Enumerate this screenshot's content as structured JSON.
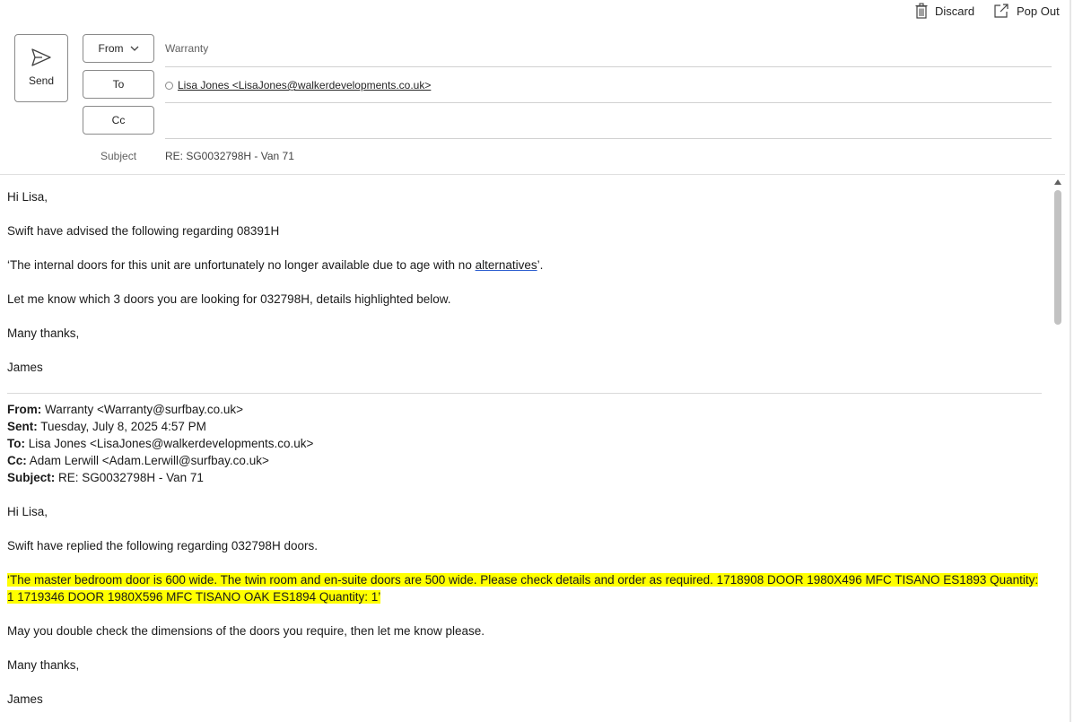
{
  "toolbar": {
    "discard_label": "Discard",
    "popout_label": "Pop Out"
  },
  "header": {
    "send_label": "Send",
    "from_label": "From",
    "to_label": "To",
    "cc_label": "Cc",
    "from_value": "Warranty",
    "to_recipient": "Lisa Jones <LisaJones@walkerdevelopments.co.uk>",
    "cc_value": "",
    "subject_label": "Subject",
    "subject_value": "RE: SG0032798H - Van 71"
  },
  "message": {
    "greeting": "Hi Lisa,",
    "line1": "Swift have advised the following regarding 08391H",
    "line2_pre": "‘The internal doors for this unit are unfortunately no longer available due to age with no ",
    "line2_link": "alternatives",
    "line2_post": "’.",
    "line3": "Let me know which 3 doors you are looking for 032798H, details highlighted below.",
    "signoff": "Many thanks,",
    "name": "James"
  },
  "quoted": {
    "from_label": "From:",
    "from_value": " Warranty <Warranty@surfbay.co.uk>",
    "sent_label": "Sent:",
    "sent_value": " Tuesday, July 8, 2025 4:57 PM",
    "to_label": "To:",
    "to_value": " Lisa Jones <LisaJones@walkerdevelopments.co.uk>",
    "cc_label": "Cc:",
    "cc_value": " Adam Lerwill <Adam.Lerwill@surfbay.co.uk>",
    "subject_label": "Subject:",
    "subject_value": " RE: SG0032798H - Van 71",
    "greeting": "Hi Lisa,",
    "line1": "Swift have replied the following regarding 032798H doors.",
    "highlight": "‘The master bedroom door is 600 wide. The twin room and en-suite doors are 500 wide. Please check details and order as required. 1718908 DOOR 1980X496 MFC TISANO ES1893 Quantity: 1 1719346 DOOR 1980X596 MFC TISANO OAK ES1894 Quantity: 1’",
    "line2": "May you double check the dimensions of the doors you require, then let me know please.",
    "signoff": "Many thanks,",
    "name": "James"
  },
  "colors": {
    "highlight": "#ffff00",
    "link_underline": "#2c5fd0"
  }
}
